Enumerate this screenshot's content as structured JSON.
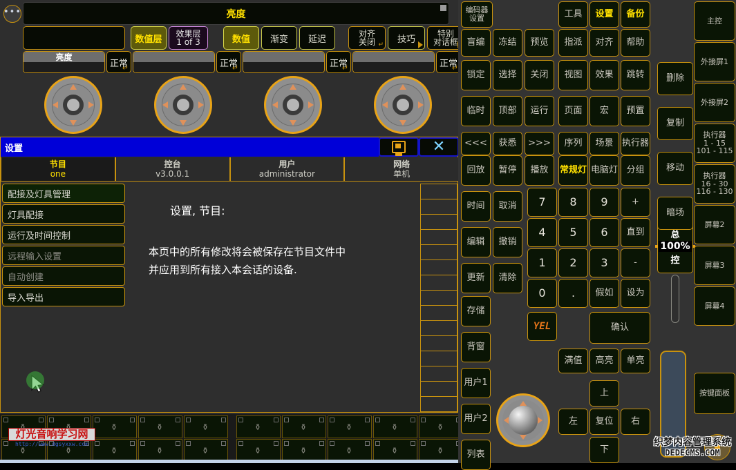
{
  "left_panel": {
    "more_button": "•••",
    "title": "亮度",
    "toolbar": [
      {
        "label": "",
        "type": "blank"
      },
      {
        "label": "数值层",
        "type": "olive"
      },
      {
        "label": "效果层",
        "sub": "1 of 3",
        "type": "violet"
      },
      {
        "label": "数值",
        "type": "olive"
      },
      {
        "label": "渐变",
        "type": "dark"
      },
      {
        "label": "延迟",
        "type": "dark"
      },
      {
        "label": "对齐",
        "sub": "关闭",
        "type": "two-hook"
      },
      {
        "label": "技巧",
        "type": "one-tri"
      },
      {
        "label": "特别",
        "sub": "对话框",
        "type": "two-tri"
      }
    ],
    "exec_row": [
      {
        "label": "亮度",
        "mode": "正常"
      },
      {
        "label": "",
        "mode": "正常"
      },
      {
        "label": "",
        "mode": "正常"
      },
      {
        "label": "",
        "mode": "正常"
      }
    ],
    "encoder_count": 4
  },
  "dialog": {
    "title": "设置",
    "monitor_icon": "monitor-icon",
    "close_icon": "close-icon",
    "tabs": [
      {
        "name": "节目",
        "value": "one",
        "active": true
      },
      {
        "name": "控台",
        "value": "v3.0.0.1",
        "active": false
      },
      {
        "name": "用户",
        "value": "administrator",
        "active": false
      },
      {
        "name": "网络",
        "value": "单机",
        "active": false
      }
    ],
    "menu": [
      {
        "label": "配接及灯具管理",
        "enabled": true,
        "selected": true
      },
      {
        "label": "灯具配接",
        "enabled": true,
        "selected": false
      },
      {
        "label": "运行及时间控制",
        "enabled": true,
        "selected": false
      },
      {
        "label": "远程输入设置",
        "enabled": false,
        "selected": false
      },
      {
        "label": "自动创建",
        "enabled": false,
        "selected": false
      },
      {
        "label": "导入导出",
        "enabled": true,
        "selected": false
      }
    ],
    "pane_heading": "设置, 节目:",
    "pane_line1": "本页中的所有修改将会被保存在节目文件中",
    "pane_line2": "并应用到所有接入本会话的设备."
  },
  "right_wing": {
    "col_a": [
      {
        "label": "编码器",
        "sub": "设置"
      },
      {
        "label": "盲编"
      },
      {
        "label": "冻结"
      },
      {
        "label": "预览"
      },
      {
        "label": "锁定"
      },
      {
        "label": "选择"
      },
      {
        "label": "关闭"
      },
      {
        "label": "临时"
      },
      {
        "label": "顶部"
      },
      {
        "label": "运行"
      },
      {
        "label": "<<<"
      },
      {
        "label": "获悉"
      },
      {
        "label": ">>>"
      },
      {
        "label": "回放"
      },
      {
        "label": "暂停"
      },
      {
        "label": "播放"
      },
      {
        "label": "时间"
      },
      {
        "label": "取消"
      },
      {
        "label": "编辑"
      },
      {
        "label": "撤销"
      },
      {
        "label": "更新"
      },
      {
        "label": "清除"
      },
      {
        "label": "存储"
      },
      {
        "label": "背窗"
      },
      {
        "label": "用户1"
      },
      {
        "label": "用户2"
      },
      {
        "label": "列表"
      }
    ],
    "col_b": [
      {
        "label": "工具"
      },
      {
        "label": "设置",
        "highlight": true
      },
      {
        "label": "备份",
        "highlight": true
      },
      {
        "label": "指派"
      },
      {
        "label": "对齐"
      },
      {
        "label": "帮助"
      },
      {
        "label": "视图"
      },
      {
        "label": "效果"
      },
      {
        "label": "跳转"
      },
      {
        "label": "页面"
      },
      {
        "label": "宏"
      },
      {
        "label": "预置"
      },
      {
        "label": "序列"
      },
      {
        "label": "场景"
      },
      {
        "label": "执行器"
      },
      {
        "label": "常规灯",
        "highlight": true
      },
      {
        "label": "电脑灯"
      },
      {
        "label": "分组"
      }
    ],
    "keypad": [
      "7",
      "8",
      "9",
      "+",
      "4",
      "5",
      "6",
      "直到",
      "1",
      "2",
      "3",
      "-",
      "0",
      ".",
      "假如",
      "设为"
    ],
    "yel_logo": "YEL",
    "confirm": "确认",
    "intensity": [
      "满值",
      "高亮",
      "单亮"
    ],
    "dpad": {
      "up": "上",
      "left": "左",
      "center": "复位",
      "right": "右",
      "down": "下"
    },
    "col_c": [
      {
        "label": "删除"
      },
      {
        "label": "复制"
      },
      {
        "label": "移动"
      },
      {
        "label": "暗场"
      }
    ],
    "master": {
      "top": "总",
      "pct": "100%",
      "bottom": "控"
    },
    "col_d": [
      {
        "lines": [
          "主控"
        ]
      },
      {
        "lines": [
          "外接屏1"
        ]
      },
      {
        "lines": [
          "外接屏2"
        ]
      },
      {
        "lines": [
          "执行器",
          "1 - 15",
          "101 - 115"
        ]
      },
      {
        "lines": [
          "执行器",
          "16 - 30",
          "116 - 130"
        ]
      },
      {
        "lines": [
          "屏幕2"
        ]
      },
      {
        "lines": [
          "屏幕3"
        ]
      },
      {
        "lines": [
          "屏幕4"
        ]
      }
    ],
    "keypanel": "按键面板"
  },
  "watermarks": {
    "left_cn": "灯光音响学习网",
    "left_url": "http://www.dgsyxxw.com",
    "right_cn": "织梦内容管理系统",
    "right_url": "DEDECMS.COM"
  },
  "colors": {
    "accent": "#c8920e",
    "highlight": "#ffe000",
    "titlebar": "#0000d8",
    "btn_bg": "#0a1505"
  }
}
